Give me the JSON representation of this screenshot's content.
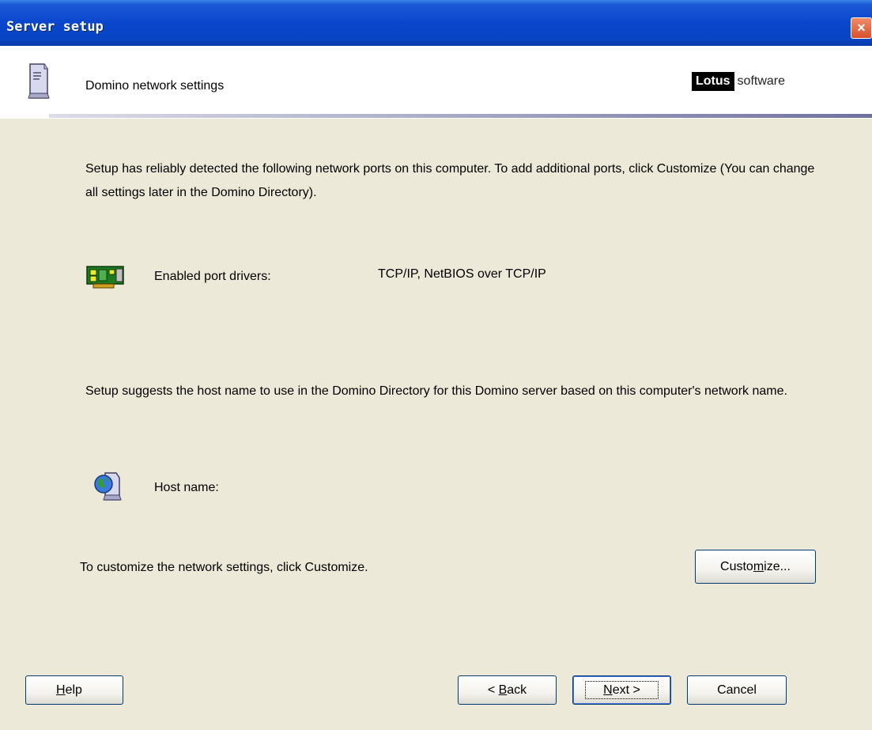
{
  "window": {
    "title": "Server setup",
    "close_label": "×"
  },
  "header": {
    "title": "Domino network settings",
    "logo_strong": "Lotus",
    "logo_light": "software"
  },
  "body": {
    "intro": "Setup has reliably detected the following network ports on this computer. To add additional ports, click Customize (You can change all settings later in the Domino Directory).",
    "ports_label": "Enabled port drivers:",
    "ports_value": "TCP/IP, NetBIOS over TCP/IP",
    "host_intro": "Setup suggests the host name to use in the Domino Directory for this Domino server based on this computer's network name.",
    "host_label": "Host name:",
    "customize_message": "To customize the network settings, click Customize."
  },
  "buttons": {
    "customize": {
      "before": "Custo",
      "mnemonic": "m",
      "after": "ize..."
    },
    "help": {
      "before": "",
      "mnemonic": "H",
      "after": "elp"
    },
    "back": {
      "before": "< ",
      "mnemonic": "B",
      "after": "ack"
    },
    "next": {
      "before": "",
      "mnemonic": "N",
      "after": "ext >"
    },
    "cancel": "Cancel"
  },
  "icons": {
    "server": "server-icon",
    "network_card": "network-card-icon",
    "globe": "globe-server-icon",
    "close": "close-icon"
  }
}
